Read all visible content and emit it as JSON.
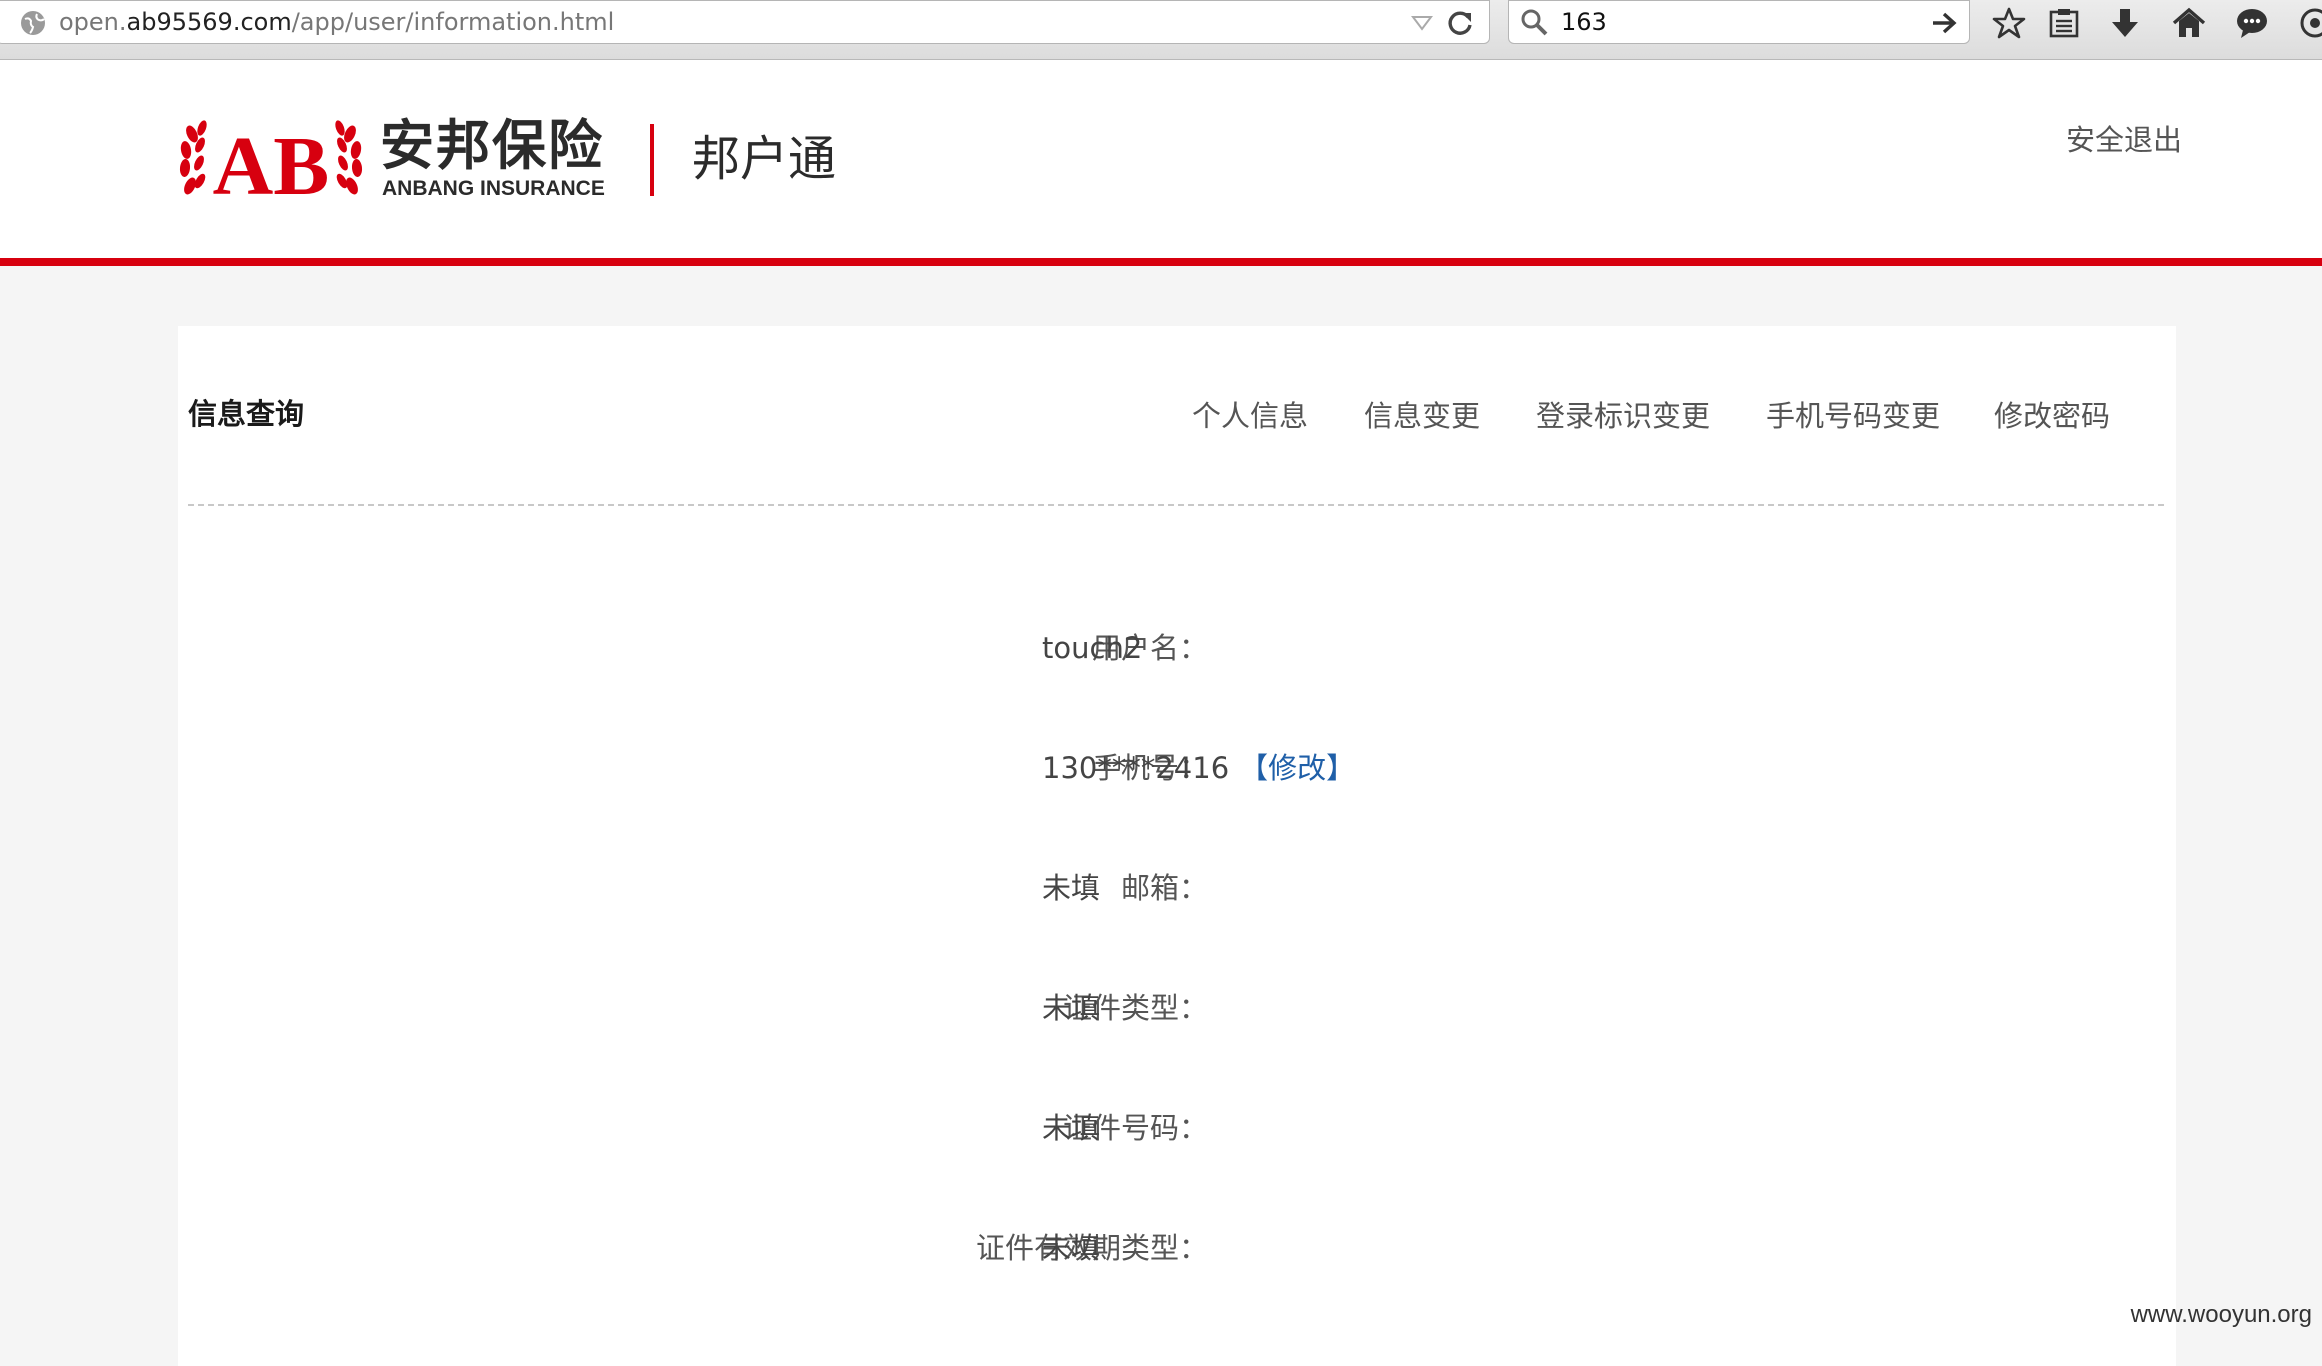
{
  "browser": {
    "url_prefix": "open.",
    "url_host": "ab95569.com",
    "url_path": "/app/user/information.html",
    "search_value": "163",
    "icons": [
      "globe-icon",
      "dropdown-icon",
      "reload-icon",
      "search-icon",
      "go-icon",
      "star-icon",
      "reading-list-icon",
      "download-icon",
      "home-icon",
      "chat-icon",
      "addon-icon"
    ]
  },
  "header": {
    "logo_cn": "安邦保险",
    "logo_en": "ANBANG INSURANCE",
    "logo_mark": "AB",
    "product_name": "邦户通",
    "logout_label": "安全退出",
    "brand_color": "#d7000f"
  },
  "main": {
    "section_title": "信息查询",
    "tabs": [
      {
        "label": "个人信息"
      },
      {
        "label": "信息变更"
      },
      {
        "label": "登录标识变更"
      },
      {
        "label": "手机号码变更"
      },
      {
        "label": "修改密码"
      }
    ],
    "fields": [
      {
        "label": "用户名：",
        "value": "touch2"
      },
      {
        "label": "手机号：",
        "value": "130****2416",
        "action": "【修改】"
      },
      {
        "label": "邮箱：",
        "value": "未填"
      },
      {
        "label": "证件类型：",
        "value": "未填"
      },
      {
        "label": "证件号码：",
        "value": "未填"
      },
      {
        "label": "证件有效期类型：",
        "value": "未填"
      }
    ],
    "link_color": "#1f5fa8"
  },
  "watermark": "www.wooyun.org"
}
